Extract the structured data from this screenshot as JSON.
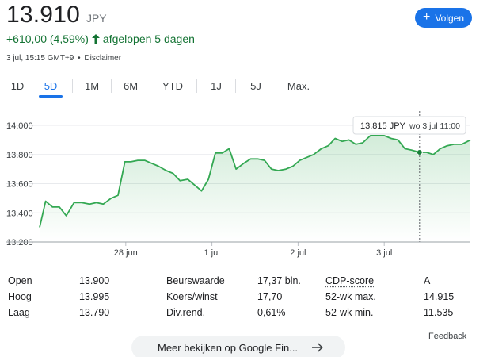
{
  "quote": {
    "price": "13.910",
    "currency": "JPY",
    "change": "+610,00 (4,59%)",
    "period": "afgelopen 5 dagen",
    "timestamp": "3 jul, 15:15 GMT+9",
    "separator": "•",
    "disclaimer": "Disclaimer"
  },
  "follow_button": {
    "label": "Volgen"
  },
  "tabs": [
    {
      "label": "1D",
      "active": false
    },
    {
      "label": "5D",
      "active": true
    },
    {
      "label": "1M",
      "active": false
    },
    {
      "label": "6M",
      "active": false
    },
    {
      "label": "YTD",
      "active": false
    },
    {
      "label": "1J",
      "active": false
    },
    {
      "label": "5J",
      "active": false
    },
    {
      "label": "Max.",
      "active": false
    }
  ],
  "colors": {
    "accent": "#1a73e8",
    "up": "#137333",
    "line": "#34a853",
    "area": "#e6f4ea"
  },
  "chart_data": {
    "type": "area",
    "ylim": [
      13200,
      14000
    ],
    "yticks": [
      "14.000",
      "13.800",
      "13.600",
      "13.400",
      "13.200"
    ],
    "ytick_values": [
      14000,
      13800,
      13600,
      13400,
      13200
    ],
    "xticks": [
      {
        "label": "28 jun",
        "x": 10
      },
      {
        "label": "1 jul",
        "x": 20
      },
      {
        "label": "2 jul",
        "x": 30
      },
      {
        "label": "3 jul",
        "x": 40
      }
    ],
    "xlim": [
      0,
      50
    ],
    "x": [
      0,
      0.7,
      1.5,
      2.3,
      3.1,
      4.0,
      4.9,
      5.8,
      6.6,
      7.4,
      8.3,
      9.1,
      9.9,
      10.6,
      11.4,
      12.2,
      13.0,
      13.8,
      14.7,
      15.5,
      16.3,
      17.2,
      18.0,
      18.8,
      19.6,
      20.4,
      21.2,
      22.0,
      22.8,
      23.7,
      24.5,
      25.3,
      26.1,
      26.9,
      27.7,
      28.6,
      29.4,
      30.2,
      31.0,
      31.8,
      32.7,
      33.5,
      34.3,
      35.1,
      35.9,
      36.7,
      37.5,
      38.4,
      39.2,
      40.0,
      40.8,
      41.6,
      42.4,
      43.2,
      44.1,
      44.9,
      45.7,
      46.5,
      47.3,
      48.1,
      49.0,
      50.0
    ],
    "values": [
      13300,
      13480,
      13440,
      13440,
      13380,
      13470,
      13470,
      13460,
      13470,
      13460,
      13500,
      13520,
      13750,
      13750,
      13760,
      13760,
      13740,
      13720,
      13690,
      13670,
      13620,
      13630,
      13590,
      13550,
      13630,
      13810,
      13810,
      13840,
      13700,
      13740,
      13770,
      13770,
      13760,
      13700,
      13690,
      13700,
      13720,
      13760,
      13780,
      13800,
      13840,
      13860,
      13910,
      13890,
      13900,
      13870,
      13880,
      13930,
      13930,
      13930,
      13910,
      13900,
      13840,
      13830,
      13815,
      13815,
      13800,
      13840,
      13860,
      13870,
      13870,
      13900,
      13910
    ],
    "tooltip": {
      "value": "13.815 JPY",
      "time": "wo 3 jul 11:00",
      "x": 44.1,
      "y": 13815
    }
  },
  "stats": [
    {
      "label": "Open",
      "value": "13.900",
      "label2": "Beurswaarde",
      "value2": "17,37 bln.",
      "label3": "CDP-score",
      "value3": "A"
    },
    {
      "label": "Hoog",
      "value": "13.995",
      "label2": "Koers/winst",
      "value2": "17,70",
      "label3": "52-wk max.",
      "value3": "14.915"
    },
    {
      "label": "Laag",
      "value": "13.790",
      "label2": "Div.rend.",
      "value2": "0,61%",
      "label3": "52-wk min.",
      "value3": "11.535"
    }
  ],
  "feedback": "Feedback",
  "more_button": {
    "label": "Meer bekijken op Google Fin..."
  }
}
